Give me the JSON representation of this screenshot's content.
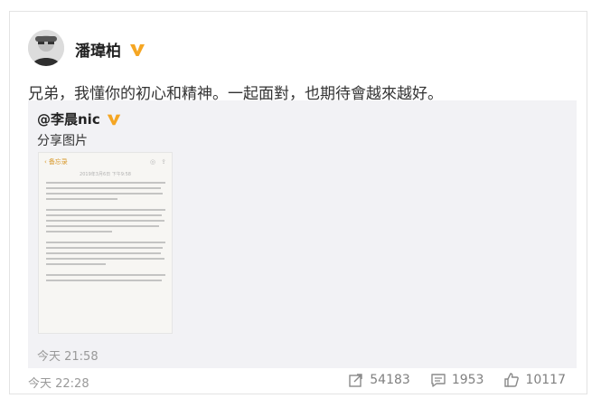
{
  "post": {
    "author": "潘瑋柏",
    "text": "兄弟，我懂你的初心和精神。一起面對，也期待會越來越好。",
    "time": "今天 22:28"
  },
  "repost": {
    "author": "@李晨nic",
    "text": "分享图片",
    "time": "今天 21:58",
    "thumbnail": {
      "back_label": "备忘录",
      "date": "2019年3月6日 下午9:58"
    }
  },
  "actions": {
    "share_count": "54183",
    "comment_count": "1953",
    "like_count": "10117"
  },
  "colors": {
    "badge": "#f5a623",
    "text": "#333333",
    "muted": "#999999",
    "repost_bg": "#f2f2f5"
  },
  "icons": {
    "verified": "verified-badge-icon",
    "share": "share-icon",
    "comment": "comment-icon",
    "like": "like-icon"
  }
}
